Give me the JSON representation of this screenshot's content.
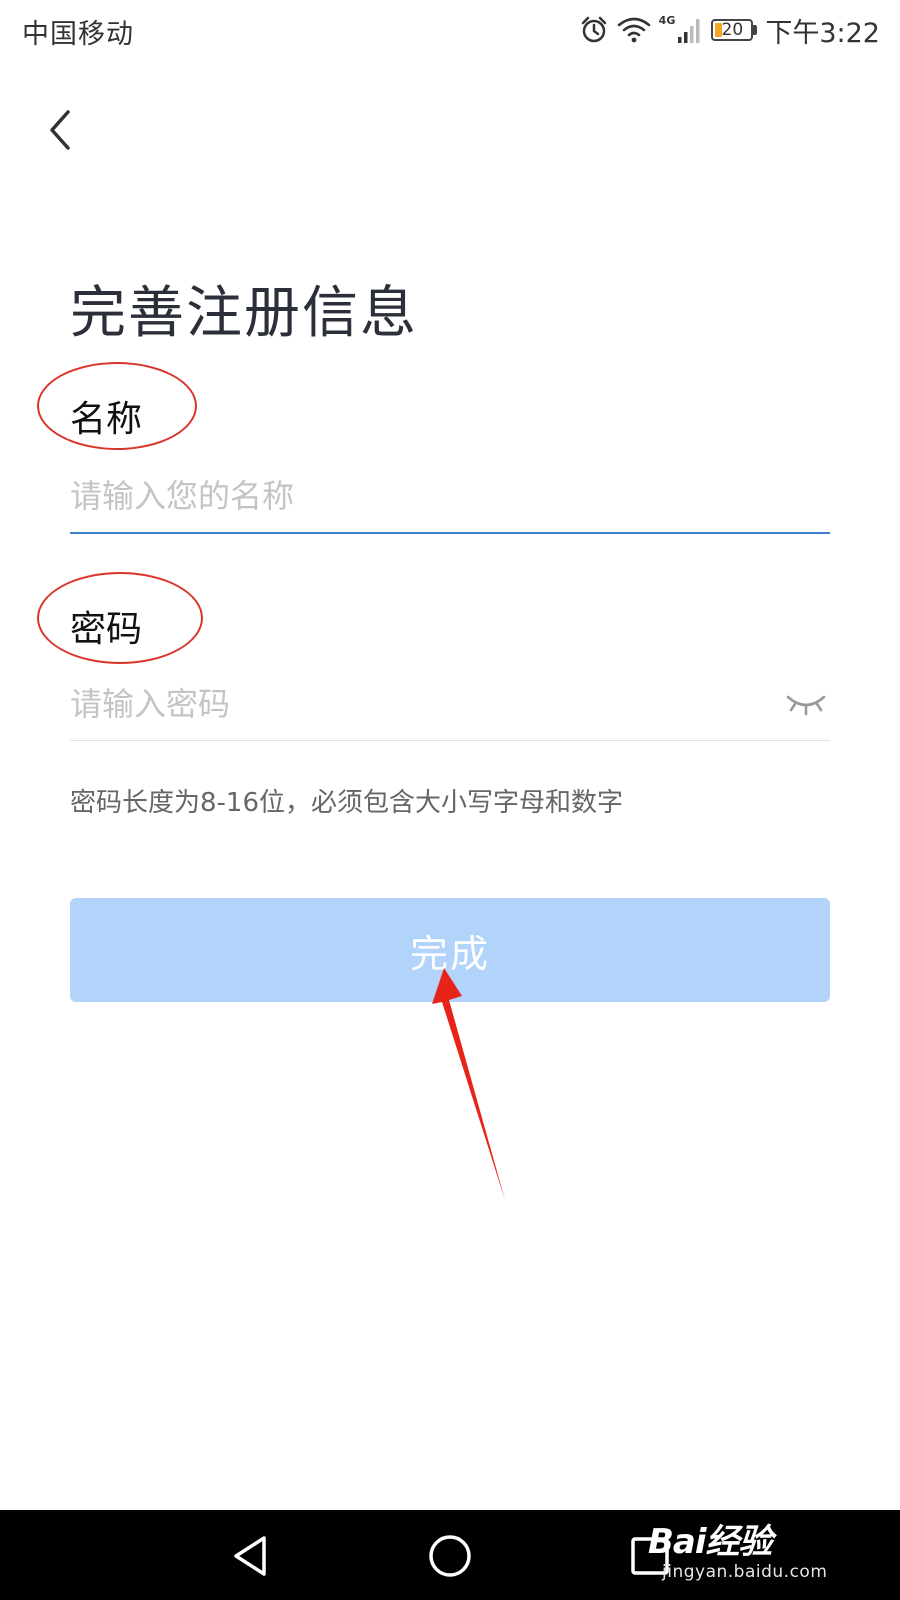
{
  "status_bar": {
    "carrier": "中国移动",
    "network_type": "4G",
    "battery_level": "20",
    "battery_fraction": 0.2,
    "time": "下午3:22",
    "icons": [
      "alarm-icon",
      "wifi-icon",
      "signal-icon",
      "battery-icon"
    ]
  },
  "header": {
    "back_icon": "chevron-left-icon"
  },
  "page": {
    "title": "完善注册信息"
  },
  "form": {
    "name_label": "名称",
    "name_placeholder": "请输入您的名称",
    "name_value": "",
    "password_label": "密码",
    "password_placeholder": "请输入密码",
    "password_value": "",
    "password_toggle_icon": "eye-closed-icon",
    "password_hint": "密码长度为8-16位，必须包含大小写字母和数字",
    "submit_label": "完成"
  },
  "colors": {
    "accent_underline": "#3d7fcf",
    "button_disabled_bg": "#b2d4fa",
    "annotation_red": "#d9362b"
  },
  "nav_bar": {
    "icons": [
      "triangle-back-icon",
      "circle-home-icon",
      "square-recent-icon"
    ]
  },
  "watermark": {
    "logo": "Bai经验",
    "url": "jingyan.baidu.com"
  }
}
